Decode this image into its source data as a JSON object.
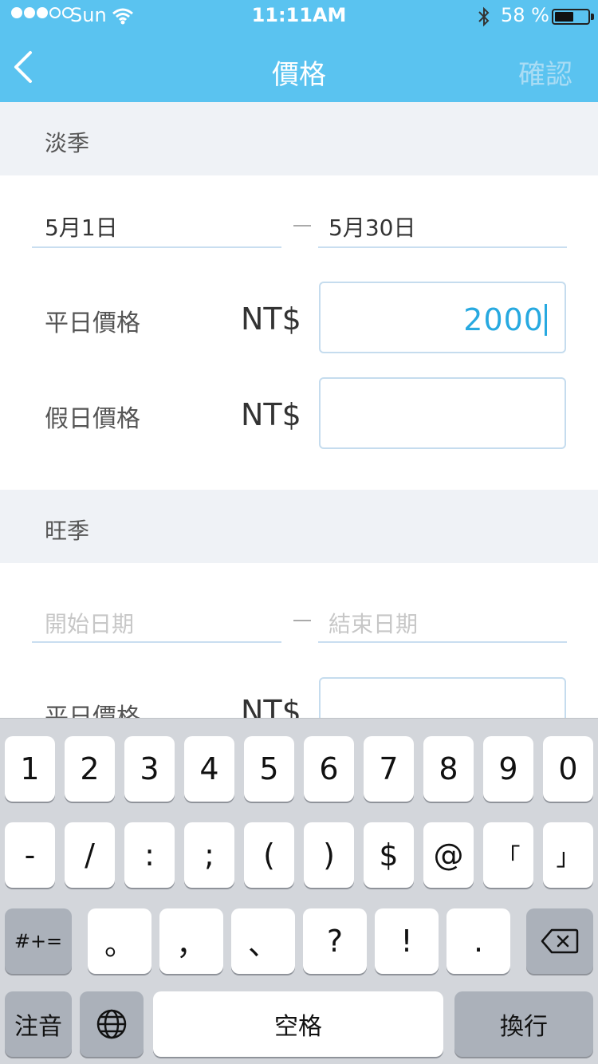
{
  "status_bar": {
    "carrier": "Sun",
    "time": "11:11AM",
    "battery_percent": "58 %",
    "battery_level": 0.58
  },
  "nav": {
    "title": "價格",
    "confirm_label": "確認",
    "back_icon": "chevron-left-icon"
  },
  "off_season": {
    "title": "淡季",
    "start_date": "5月1日",
    "end_date": "5月30日",
    "weekday_label": "平日價格",
    "weekday_currency": "NT$",
    "weekday_value": "2000",
    "holiday_label": "假日價格",
    "holiday_currency": "NT$",
    "holiday_value": ""
  },
  "peak_season": {
    "title": "旺季",
    "start_placeholder": "開始日期",
    "end_placeholder": "結束日期",
    "weekday_label": "平日價格",
    "weekday_currency": "NT$"
  },
  "keyboard": {
    "row1": [
      "1",
      "2",
      "3",
      "4",
      "5",
      "6",
      "7",
      "8",
      "9",
      "0"
    ],
    "row2": [
      "-",
      "/",
      ":",
      ";",
      "(",
      ")",
      "$",
      "@",
      "「",
      "」"
    ],
    "row3_left": "#+=",
    "row3": [
      "。",
      "，",
      "、",
      "?",
      "!",
      "."
    ],
    "mode_label": "注音",
    "space_label": "空格",
    "return_label": "換行"
  },
  "colors": {
    "header": "#5ac3f0",
    "accent_text": "#27a9e0",
    "section_bg": "#eff2f6"
  }
}
